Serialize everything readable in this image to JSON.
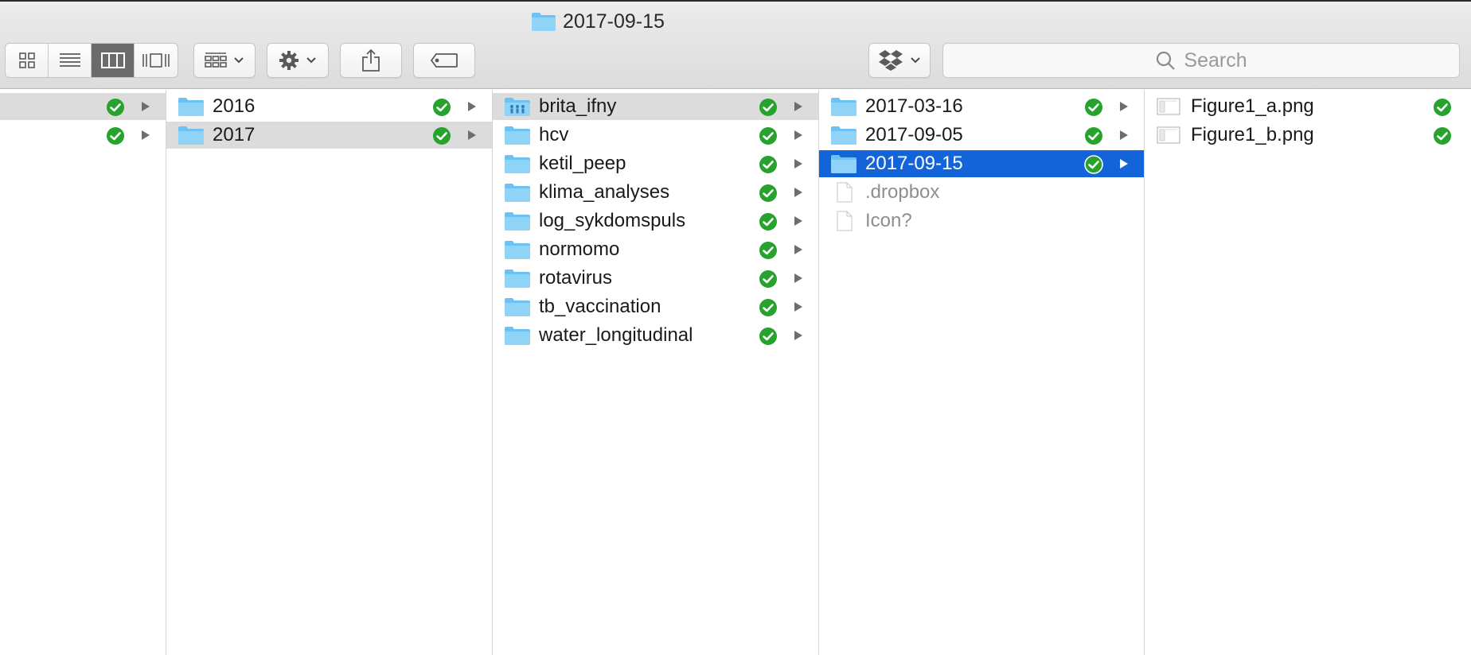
{
  "window": {
    "title": "2017-09-15"
  },
  "toolbar": {
    "view_modes": [
      "icon-view",
      "list-view",
      "column-view",
      "cover-flow-view"
    ],
    "active_view": "column-view",
    "search_placeholder": "Search"
  },
  "colors": {
    "selection_blue": "#1264d8",
    "selection_gray": "#dcdcdc",
    "folder_blue": "#6cc2f2",
    "sync_green": "#27a22d"
  },
  "columns": [
    {
      "items": [
        {
          "label": "",
          "kind": "folder",
          "synced": true,
          "has_children": true,
          "selected": "gray"
        },
        {
          "label": "",
          "kind": "folder",
          "synced": true,
          "has_children": true,
          "selected": ""
        }
      ]
    },
    {
      "items": [
        {
          "label": "2016",
          "kind": "folder",
          "synced": true,
          "has_children": true,
          "selected": ""
        },
        {
          "label": "2017",
          "kind": "folder",
          "synced": true,
          "has_children": true,
          "selected": "gray"
        }
      ]
    },
    {
      "items": [
        {
          "label": "brita_ifny",
          "kind": "shared-folder",
          "synced": true,
          "has_children": true,
          "selected": "gray"
        },
        {
          "label": "hcv",
          "kind": "folder",
          "synced": true,
          "has_children": true,
          "selected": ""
        },
        {
          "label": "ketil_peep",
          "kind": "folder",
          "synced": true,
          "has_children": true,
          "selected": ""
        },
        {
          "label": "klima_analyses",
          "kind": "folder",
          "synced": true,
          "has_children": true,
          "selected": ""
        },
        {
          "label": "log_sykdomspuls",
          "kind": "folder",
          "synced": true,
          "has_children": true,
          "selected": ""
        },
        {
          "label": "normomo",
          "kind": "folder",
          "synced": true,
          "has_children": true,
          "selected": ""
        },
        {
          "label": "rotavirus",
          "kind": "folder",
          "synced": true,
          "has_children": true,
          "selected": ""
        },
        {
          "label": "tb_vaccination",
          "kind": "folder",
          "synced": true,
          "has_children": true,
          "selected": ""
        },
        {
          "label": "water_longitudinal",
          "kind": "folder",
          "synced": true,
          "has_children": true,
          "selected": ""
        }
      ]
    },
    {
      "items": [
        {
          "label": "2017-03-16",
          "kind": "folder",
          "synced": true,
          "has_children": true,
          "selected": ""
        },
        {
          "label": "2017-09-05",
          "kind": "folder",
          "synced": true,
          "has_children": true,
          "selected": ""
        },
        {
          "label": "2017-09-15",
          "kind": "folder",
          "synced": true,
          "has_children": true,
          "selected": "blue"
        },
        {
          "label": ".dropbox",
          "kind": "file",
          "synced": false,
          "has_children": false,
          "selected": "",
          "dim": true
        },
        {
          "label": "Icon?",
          "kind": "file",
          "synced": false,
          "has_children": false,
          "selected": "",
          "dim": true
        }
      ]
    },
    {
      "items": [
        {
          "label": "Figure1_a.png",
          "kind": "image",
          "synced": true,
          "has_children": false,
          "selected": ""
        },
        {
          "label": "Figure1_b.png",
          "kind": "image",
          "synced": true,
          "has_children": false,
          "selected": ""
        }
      ]
    }
  ]
}
